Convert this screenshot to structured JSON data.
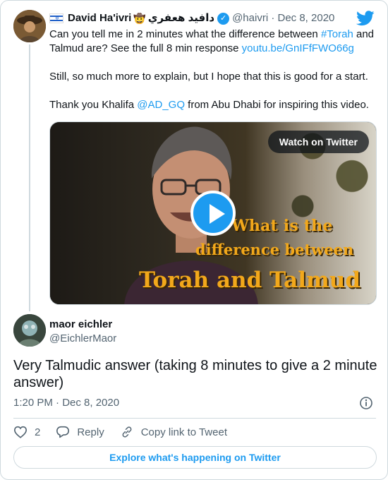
{
  "tweet": {
    "author_name": "David Ha'ivri",
    "author_name_arabic": "دافيد هعفري",
    "handle": "@haivri",
    "date": "Dec 8, 2020",
    "text_line1_a": "Can you tell me in 2 minutes what the difference between ",
    "hashtag": "#Torah",
    "text_line1_b": " and Talmud are? See the full 8 min response ",
    "link": "youtu.be/GnIFfFWO66g",
    "text_p2": "Still, so much more to explain, but I hope that this is good for a start.",
    "text_p3_a": "Thank you Khalifa ",
    "mention": "@AD_GQ",
    "text_p3_b": " from Abu Dhabi for inspiring this video.",
    "media": {
      "watch_label": "Watch on Twitter",
      "overlay_line1": "What is the",
      "overlay_line2": "difference between",
      "overlay_line3": "Torah and Talmud"
    }
  },
  "reply": {
    "name": "maor eichler",
    "handle": "@EichlerMaor",
    "text": "Very Talmudic answer (taking 8 minutes to give a 2 minute answer)",
    "time": "1:20 PM · Dec 8, 2020",
    "like_count": "2",
    "reply_label": "Reply",
    "copy_link_label": "Copy link to Tweet",
    "explore_label": "Explore what's happening on Twitter"
  },
  "colors": {
    "accent": "#1d9bf0",
    "muted": "#536471",
    "border": "#cfd9de",
    "overlay_text": "#f2a81b"
  },
  "icons": {
    "brand": "twitter-bird-icon",
    "verified": "verified-badge-icon",
    "play": "play-icon",
    "info": "info-icon",
    "like": "heart-icon",
    "reply": "reply-icon",
    "copy": "link-icon",
    "flag": "israel-flag-icon"
  }
}
